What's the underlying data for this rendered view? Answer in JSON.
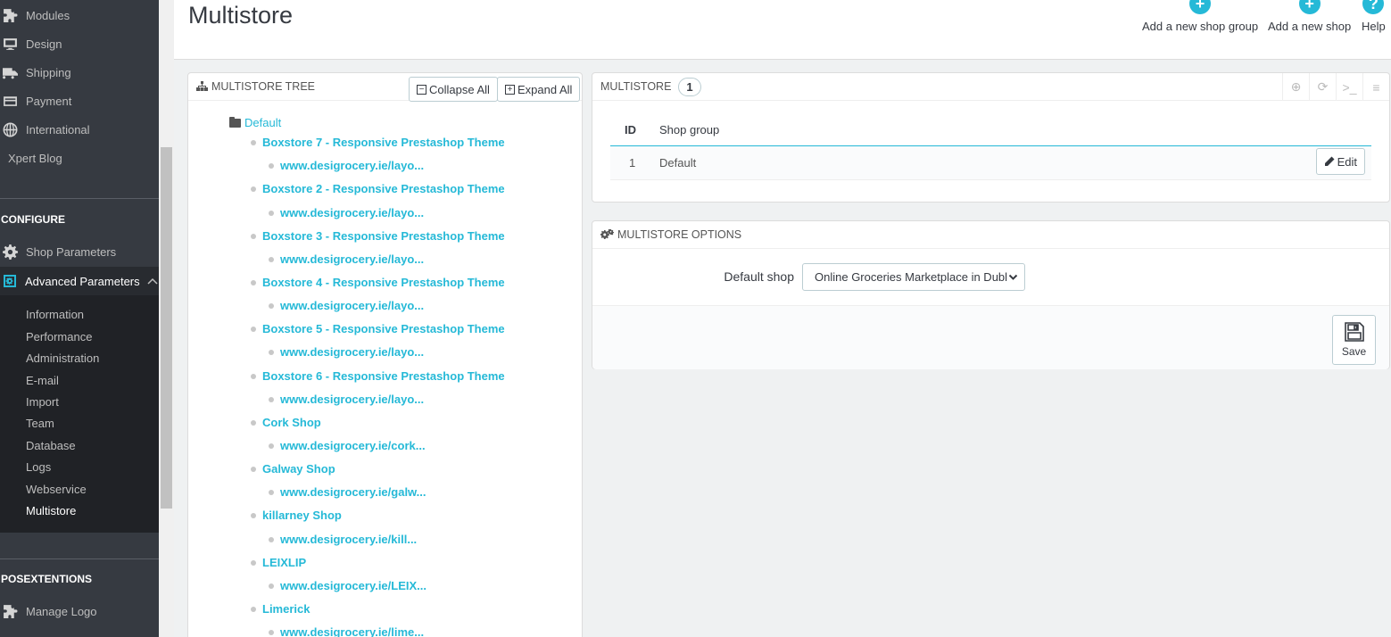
{
  "sidebar": {
    "top_items": [
      {
        "label": "Modules",
        "icon": "puzzle-icon"
      },
      {
        "label": "Design",
        "icon": "monitor-icon"
      },
      {
        "label": "Shipping",
        "icon": "truck-icon"
      },
      {
        "label": "Payment",
        "icon": "card-icon"
      },
      {
        "label": "International",
        "icon": "globe-icon"
      },
      {
        "label": "Xpert Blog",
        "icon": ""
      }
    ],
    "configure_heading": "CONFIGURE",
    "shop_parameters": "Shop Parameters",
    "advanced_parameters": "Advanced Parameters",
    "sub_items": [
      "Information",
      "Performance",
      "Administration",
      "E-mail",
      "Import",
      "Team",
      "Database",
      "Logs",
      "Webservice",
      "Multistore"
    ],
    "posextentions_heading": "POSEXTENTIONS",
    "manage_logo": "Manage Logo"
  },
  "header": {
    "title": "Multistore",
    "actions": [
      {
        "label": "Add a new shop group",
        "icon": "plus-circle-icon"
      },
      {
        "label": "Add a new shop",
        "icon": "plus-circle-icon"
      },
      {
        "label": "Help",
        "icon": "help-icon"
      }
    ]
  },
  "tree": {
    "title": "MULTISTORE TREE",
    "collapse_label": "Collapse All",
    "expand_label": "Expand All",
    "root": "Default",
    "shops": [
      {
        "name": "Boxstore 7 - Responsive Prestashop Theme",
        "url": "www.desigrocery.ie/layo..."
      },
      {
        "name": "Boxstore 2 - Responsive Prestashop Theme",
        "url": "www.desigrocery.ie/layo..."
      },
      {
        "name": "Boxstore 3 - Responsive Prestashop Theme",
        "url": "www.desigrocery.ie/layo..."
      },
      {
        "name": "Boxstore 4 - Responsive Prestashop Theme",
        "url": "www.desigrocery.ie/layo..."
      },
      {
        "name": "Boxstore 5 - Responsive Prestashop Theme",
        "url": "www.desigrocery.ie/layo..."
      },
      {
        "name": "Boxstore 6 - Responsive Prestashop Theme",
        "url": "www.desigrocery.ie/layo..."
      },
      {
        "name": "Cork Shop",
        "url": "www.desigrocery.ie/cork..."
      },
      {
        "name": "Galway Shop",
        "url": "www.desigrocery.ie/galw..."
      },
      {
        "name": "killarney Shop",
        "url": "www.desigrocery.ie/kill..."
      },
      {
        "name": "LEIXLIP",
        "url": "www.desigrocery.ie/LEIX..."
      },
      {
        "name": "Limerick",
        "url": "www.desigrocery.ie/lime..."
      }
    ]
  },
  "multistore": {
    "title": "MULTISTORE",
    "count": "1",
    "columns": {
      "id": "ID",
      "group": "Shop group"
    },
    "rows": [
      {
        "id": "1",
        "group": "Default"
      }
    ],
    "edit_label": "Edit"
  },
  "options": {
    "title": "MULTISTORE OPTIONS",
    "default_shop_label": "Default shop",
    "default_shop_value": "Online Groceries Marketplace in Dubl",
    "save_label": "Save"
  },
  "colors": {
    "accent": "#25b9d7",
    "sidebar": "#363a41"
  }
}
